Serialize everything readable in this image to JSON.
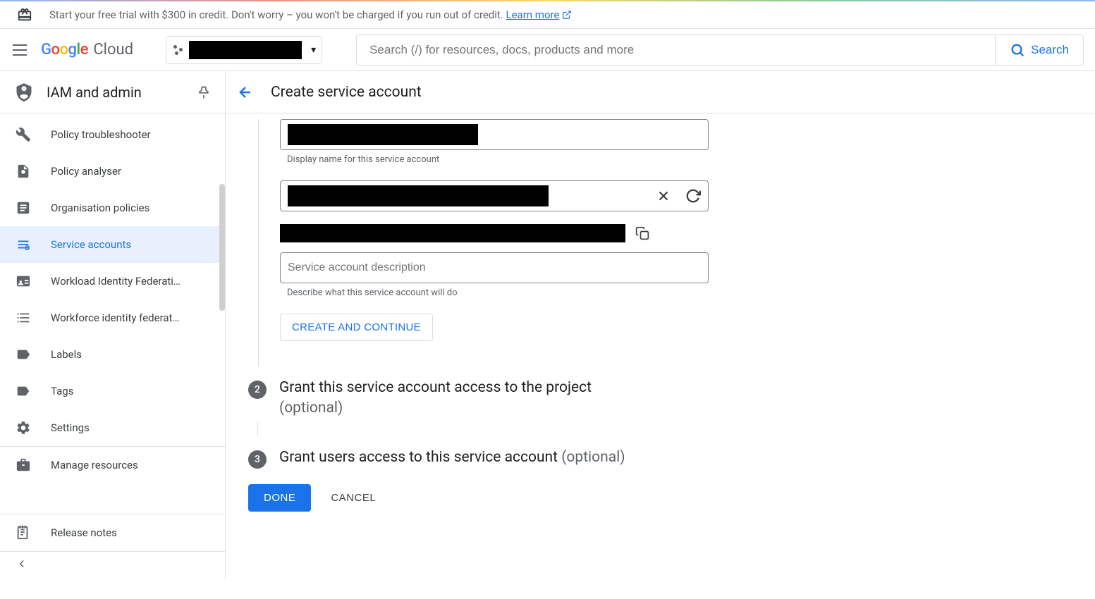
{
  "trial": {
    "text": "Start your free trial with $300 in credit. Don't worry – you won't be charged if you run out of credit.",
    "learn_more": "Learn more"
  },
  "header": {
    "logo_cloud": "Cloud",
    "search_placeholder": "Search (/) for resources, docs, products and more",
    "search_button": "Search"
  },
  "sidebar": {
    "title": "IAM and admin",
    "items": [
      {
        "label": "Policy troubleshooter",
        "icon": "wrench"
      },
      {
        "label": "Policy analyser",
        "icon": "policy"
      },
      {
        "label": "Organisation policies",
        "icon": "article"
      },
      {
        "label": "Service accounts",
        "icon": "service",
        "active": true
      },
      {
        "label": "Workload Identity Federati…",
        "icon": "badge"
      },
      {
        "label": "Workforce identity federat…",
        "icon": "list"
      },
      {
        "label": "Labels",
        "icon": "label"
      },
      {
        "label": "Tags",
        "icon": "tag"
      },
      {
        "label": "Settings",
        "icon": "settings"
      },
      {
        "label": "Manage resources",
        "icon": "briefcase"
      }
    ],
    "release_notes": "Release notes"
  },
  "main": {
    "page_title": "Create service account",
    "helper_display_name": "Display name for this service account",
    "helper_description": "Describe what this service account will do",
    "desc_placeholder": "Service account description",
    "create_continue": "CREATE AND CONTINUE",
    "step2_title": "Grant this service account access to the project",
    "step2_num": "2",
    "step3_title": "Grant users access to this service account",
    "step3_num": "3",
    "optional": "(optional)",
    "done": "DONE",
    "cancel": "CANCEL"
  }
}
